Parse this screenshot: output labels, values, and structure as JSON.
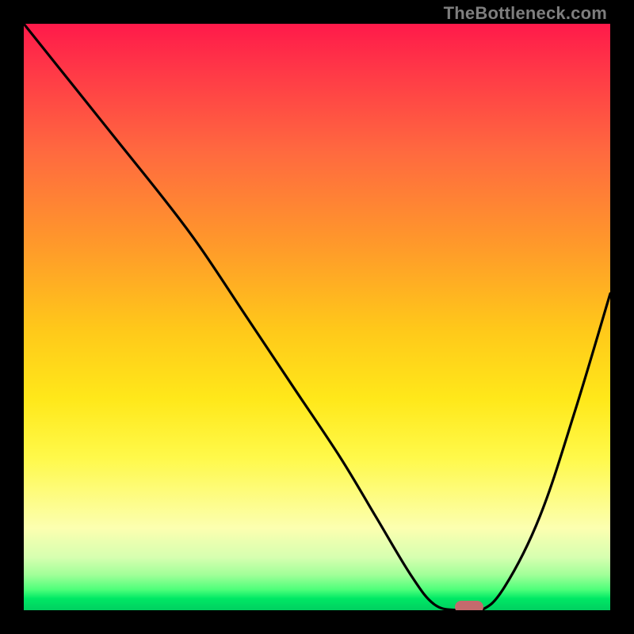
{
  "watermark": "TheBottleneck.com",
  "colors": {
    "frame": "#000000",
    "marker": "#c46a6d",
    "curve": "#000000"
  },
  "chart_data": {
    "type": "line",
    "title": "",
    "xlabel": "",
    "ylabel": "",
    "xlim": [
      0,
      100
    ],
    "ylim": [
      0,
      100
    ],
    "legend": false,
    "grid": false,
    "background": "heatmap-gradient",
    "gradient_stops": [
      {
        "pos": 0,
        "color": "#ff1a4a"
      },
      {
        "pos": 22,
        "color": "#ff6a3f"
      },
      {
        "pos": 52,
        "color": "#ffc81a"
      },
      {
        "pos": 74,
        "color": "#fff94a"
      },
      {
        "pos": 94,
        "color": "#a0ff98"
      },
      {
        "pos": 100,
        "color": "#00d060"
      }
    ],
    "series": [
      {
        "name": "bottleneck-curve",
        "x": [
          0,
          8,
          16,
          24,
          30,
          38,
          46,
          54,
          60,
          66,
          70,
          74,
          78,
          82,
          88,
          94,
          100
        ],
        "values": [
          100,
          90,
          80,
          70,
          62,
          50,
          38,
          26,
          16,
          6,
          1,
          0,
          0,
          4,
          16,
          34,
          54
        ]
      }
    ],
    "marker": {
      "x": 76,
      "y": 0
    }
  }
}
